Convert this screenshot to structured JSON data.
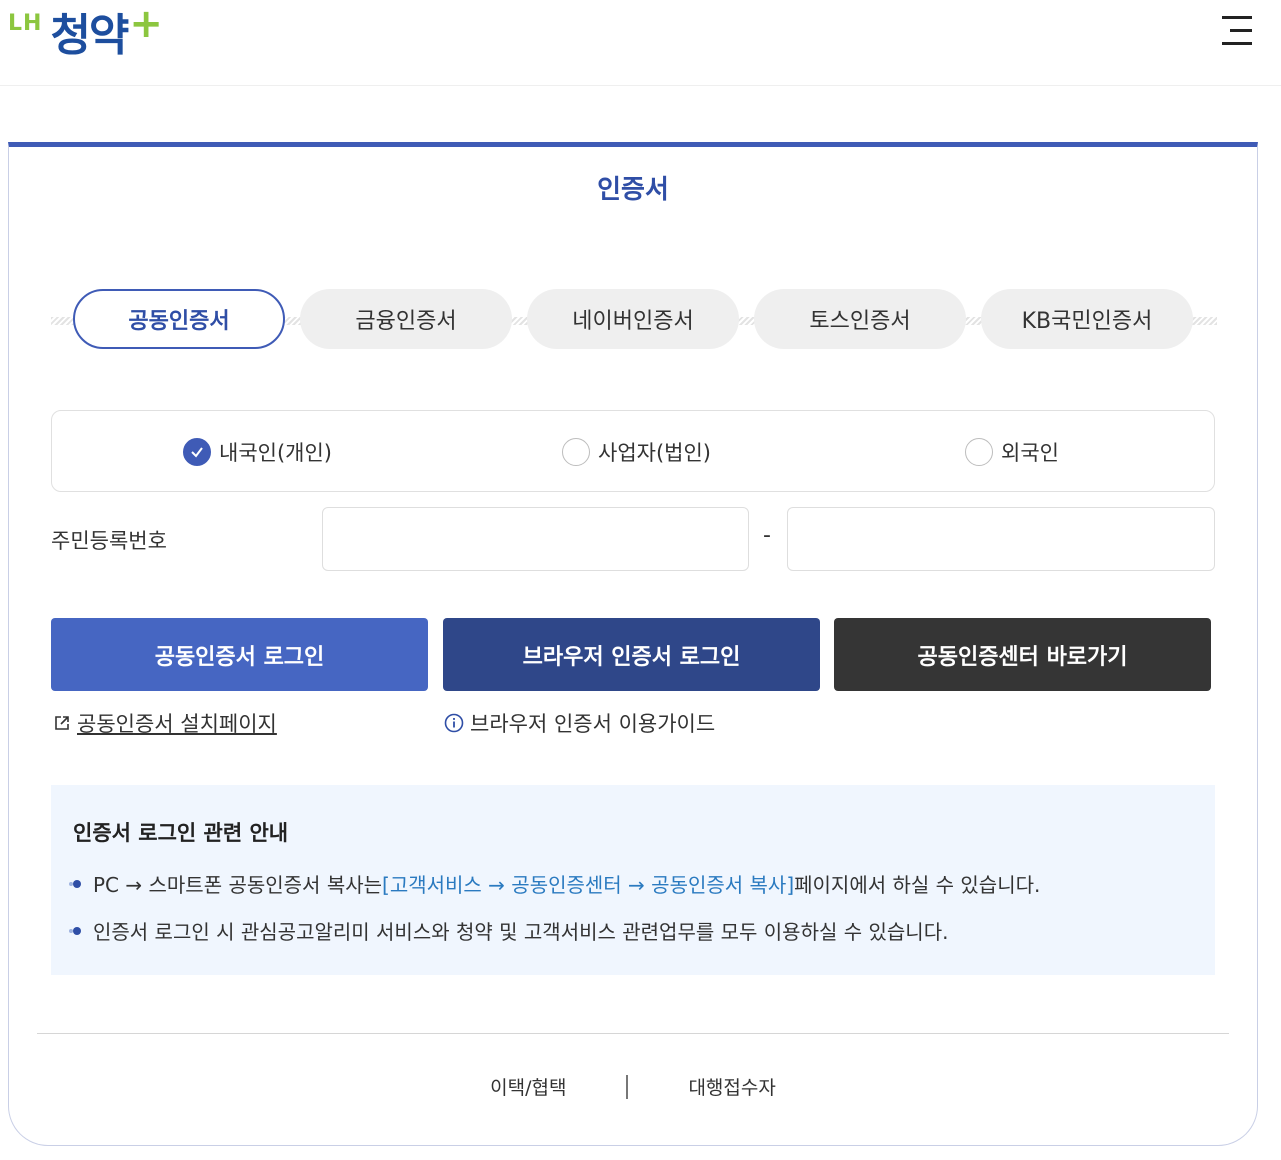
{
  "header": {
    "logo_lh": "LH",
    "logo_main": "청약",
    "logo_plus": "+",
    "menu_icon": "hamburger-menu-icon"
  },
  "card": {
    "title": "인증서",
    "tabs": [
      {
        "label": "공동인증서",
        "active": true
      },
      {
        "label": "금융인증서",
        "active": false
      },
      {
        "label": "네이버인증서",
        "active": false
      },
      {
        "label": "토스인증서",
        "active": false
      },
      {
        "label": "KB국민인증서",
        "active": false
      }
    ],
    "user_types": [
      {
        "label": "내국인(개인)",
        "checked": true
      },
      {
        "label": "사업자(법인)",
        "checked": false
      },
      {
        "label": "외국인",
        "checked": false
      }
    ],
    "ssn": {
      "label": "주민등록번호",
      "front_value": "",
      "back_value": "",
      "dash": "-"
    },
    "buttons": {
      "joint_login": "공동인증서 로그인",
      "browser_login": "브라우저 인증서 로그인",
      "center_link": "공동인증센터 바로가기"
    },
    "links": {
      "install_page": "공동인증서 설치페이지",
      "browser_guide": "브라우저 인증서 이용가이드"
    },
    "notice": {
      "title": "인증서 로그인 관련 안내",
      "item1_pre": "PC → 스마트폰 공동인증서 복사는 ",
      "item1_highlight": "[고객서비스 → 공동인증센터 → 공동인증서 복사]",
      "item1_post": " 페이지에서 하실 수 있습니다.",
      "item2": "인증서 로그인 시 관심공고알리미 서비스와 청약 및 고객서비스 관련업무를 모두 이용하실 수 있습니다."
    },
    "footer": {
      "link1": "이택/협택",
      "link2": "대행접수자"
    }
  },
  "colors": {
    "accent": "#3f5bb6",
    "title_blue": "#2f4ea6",
    "btn_primary": "#4666c2",
    "btn_secondary": "#2f4789",
    "btn_dark": "#353535",
    "notice_bg": "#f0f6fe",
    "logo_green": "#8cc63f",
    "logo_blue": "#1d4e9e"
  }
}
